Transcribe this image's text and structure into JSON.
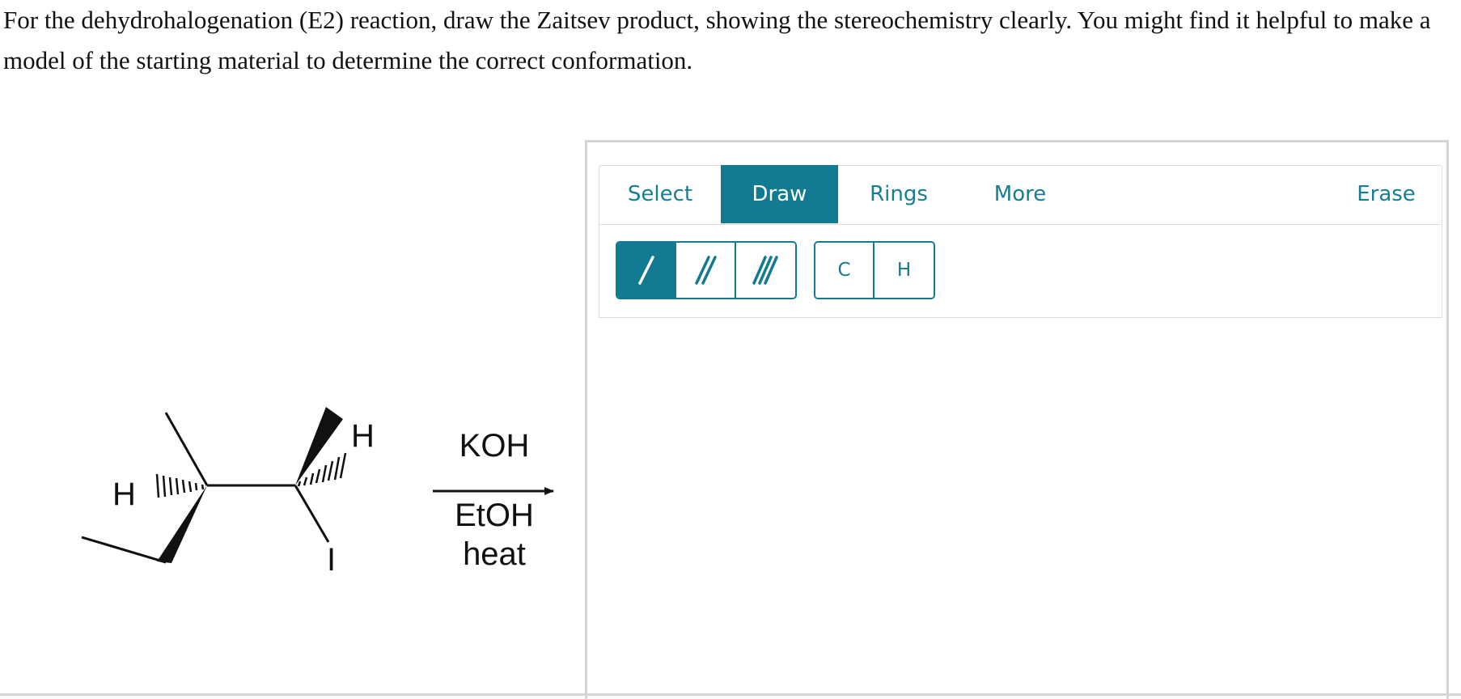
{
  "question": {
    "text": "For the dehydrohalogenation (E2) reaction, draw the Zaitsev product, showing the stereochemistry clearly. You might find it helpful to make a model of the starting material to determine the correct conformation."
  },
  "reaction": {
    "atoms": {
      "h_left": "H",
      "h_right": "H",
      "iodine": "I"
    },
    "reagent_above": "KOH",
    "reagent_below_1": "EtOH",
    "reagent_below_2": "heat"
  },
  "sketcher": {
    "tabs": [
      {
        "label": "Select",
        "active": false
      },
      {
        "label": "Draw",
        "active": true
      },
      {
        "label": "Rings",
        "active": false
      },
      {
        "label": "More",
        "active": false
      }
    ],
    "erase_label": "Erase",
    "bond_tools": [
      {
        "icon": "single-bond-icon",
        "active": true
      },
      {
        "icon": "double-bond-icon",
        "active": false
      },
      {
        "icon": "triple-bond-icon",
        "active": false
      }
    ],
    "atom_tools": [
      "C",
      "H"
    ],
    "colors": {
      "accent": "#127a91",
      "border": "#d5d5d5"
    }
  }
}
